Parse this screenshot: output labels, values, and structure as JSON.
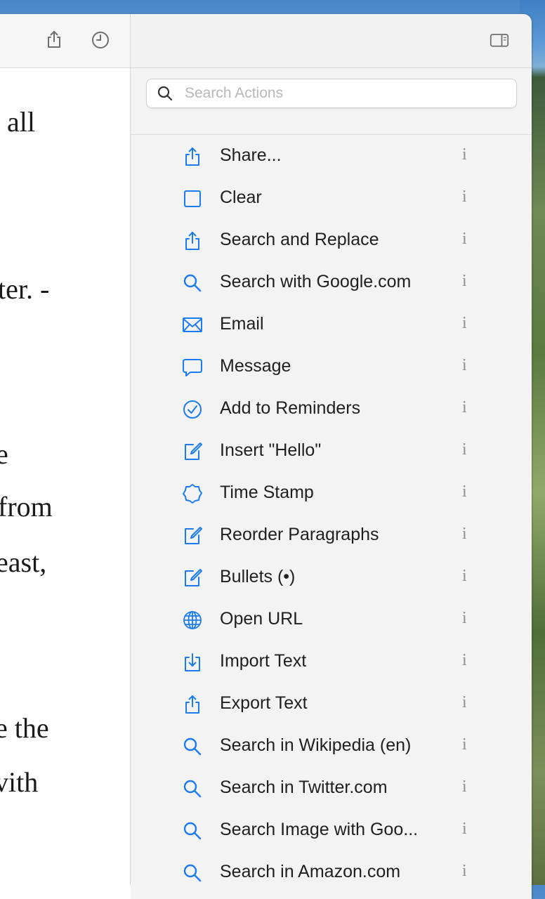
{
  "document": {
    "lines": [
      "all",
      "ter. -",
      "e",
      "from",
      "east,",
      "e the",
      "vith"
    ]
  },
  "search": {
    "placeholder": "Search Actions",
    "value": ""
  },
  "actions": [
    {
      "label": "Share...",
      "icon": "share-icon",
      "info": "i"
    },
    {
      "label": "Clear",
      "icon": "square-icon",
      "info": "i"
    },
    {
      "label": "Search and Replace",
      "icon": "share-icon",
      "info": "i"
    },
    {
      "label": "Search with Google.com",
      "icon": "search-icon",
      "info": "i"
    },
    {
      "label": "Email",
      "icon": "envelope-icon",
      "info": "i"
    },
    {
      "label": "Message",
      "icon": "message-bubble-icon",
      "info": "i"
    },
    {
      "label": "Add to Reminders",
      "icon": "checkmark-circle-icon",
      "info": "i"
    },
    {
      "label": "Insert \"Hello\"",
      "icon": "compose-icon",
      "info": "i"
    },
    {
      "label": "Time Stamp",
      "icon": "gear-badge-icon",
      "info": "i"
    },
    {
      "label": "Reorder Paragraphs",
      "icon": "compose-icon",
      "info": "i"
    },
    {
      "label": "Bullets (•)",
      "icon": "compose-icon",
      "info": "i"
    },
    {
      "label": "Open URL",
      "icon": "globe-icon",
      "info": "i"
    },
    {
      "label": "Import Text",
      "icon": "import-icon",
      "info": "i"
    },
    {
      "label": "Export Text",
      "icon": "share-icon",
      "info": "i"
    },
    {
      "label": "Search in Wikipedia (en)",
      "icon": "search-icon",
      "info": "i"
    },
    {
      "label": "Search in Twitter.com",
      "icon": "search-icon",
      "info": "i"
    },
    {
      "label": "Search Image with Goo...",
      "icon": "search-icon",
      "info": "i"
    },
    {
      "label": "Search in Amazon.com",
      "icon": "search-icon",
      "info": "i"
    }
  ],
  "colors": {
    "accent": "#1a7cf0",
    "info": "#8e8e93"
  }
}
